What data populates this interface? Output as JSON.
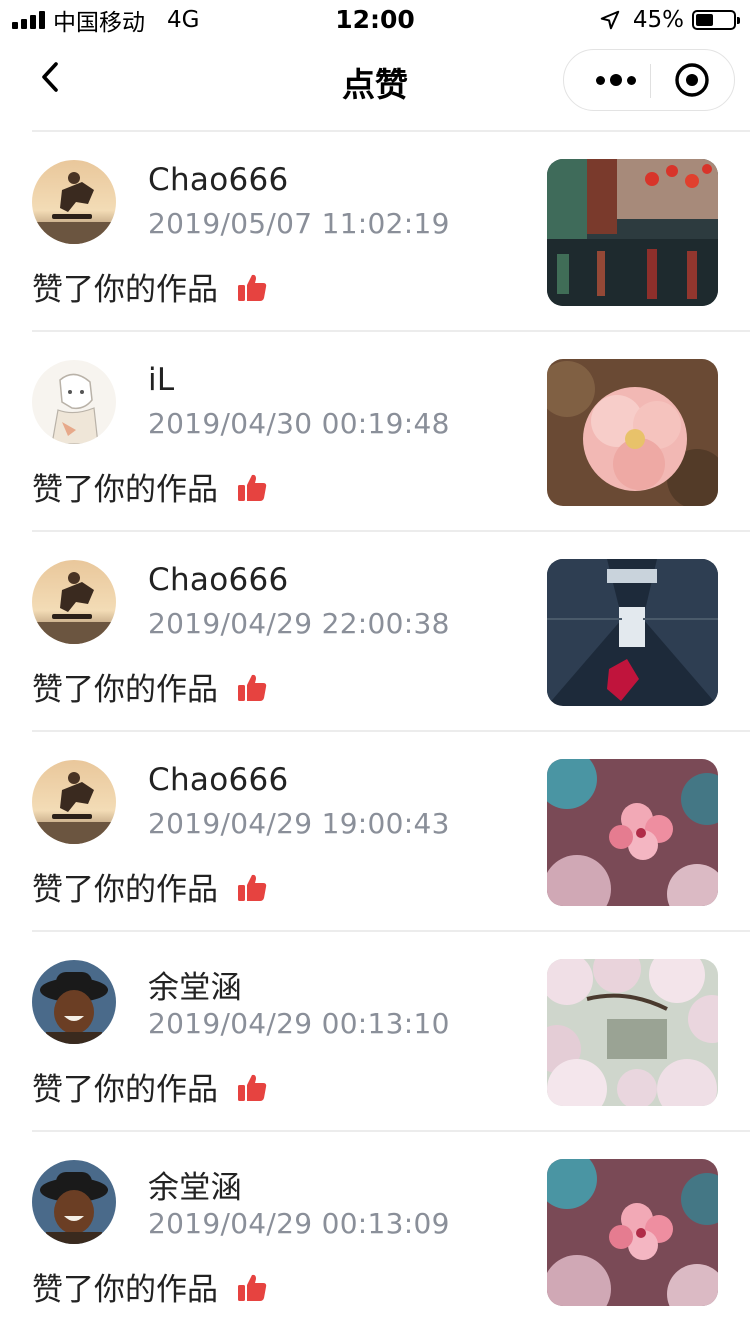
{
  "status_bar": {
    "carrier": "中国移动",
    "network": "4G",
    "time": "12:00",
    "battery_percent": "45%",
    "battery_level": 0.45,
    "icons": [
      "signal-icon",
      "location-arrow-icon",
      "battery-icon"
    ]
  },
  "nav": {
    "title": "点赞",
    "icons": [
      "back-chevron-icon",
      "more-dots-icon",
      "close-target-icon"
    ]
  },
  "likes": [
    {
      "username": "Chao666",
      "time": "2019/05/07 11:02:19",
      "action": "赞了你的作品",
      "avatar": "skateboarder",
      "photo": "street-lanterns"
    },
    {
      "username": "iL",
      "time": "2019/04/30 00:19:48",
      "action": "赞了你的作品",
      "avatar": "sketch-character",
      "photo": "pink-rose"
    },
    {
      "username": "Chao666",
      "time": "2019/04/29 22:00:38",
      "action": "赞了你的作品",
      "avatar": "skateboarder",
      "photo": "overpass"
    },
    {
      "username": "Chao666",
      "time": "2019/04/29 19:00:43",
      "action": "赞了你的作品",
      "avatar": "skateboarder",
      "photo": "pink-blossom"
    },
    {
      "username": "余堂涵",
      "time": "2019/04/29 00:13:10",
      "action": "赞了你的作品",
      "avatar": "smiling-person-hat",
      "photo": "cherry-tree-path"
    },
    {
      "username": "余堂涵",
      "time": "2019/04/29 00:13:09",
      "action": "赞了你的作品",
      "avatar": "smiling-person-hat",
      "photo": "pink-blossom"
    }
  ],
  "colors": {
    "like_icon": "#e64340",
    "time_text": "#8a8f99",
    "separator": "#ececec"
  }
}
